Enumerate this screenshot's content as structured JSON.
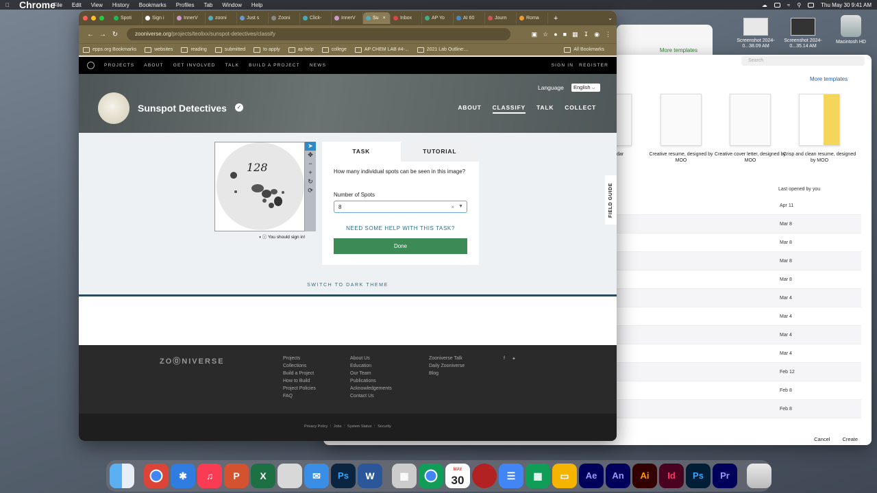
{
  "menubar": {
    "app": "Chrome",
    "items": [
      "File",
      "Edit",
      "View",
      "History",
      "Bookmarks",
      "Profiles",
      "Tab",
      "Window",
      "Help"
    ],
    "clock": "Thu May 30  9:41 AM"
  },
  "desktop": {
    "icons": [
      {
        "label": "Screenshot 2024-0...38.09 AM"
      },
      {
        "label": "Screenshot 2024-0...35.14 AM"
      },
      {
        "label": "Macintosh HD"
      }
    ]
  },
  "docwin": {
    "more_templates": "More templates",
    "templates": [
      {
        "label": "dar"
      },
      {
        "label": "Creative resume, designed by MOO"
      },
      {
        "label": "Creative cover letter, designed by MOO"
      },
      {
        "label": "Crisp and clean resume, designed by MOO"
      }
    ],
    "search_placeholder": "Search",
    "col_header": "Last opened by you",
    "rows": [
      "Apr 11",
      "Mar 8",
      "Mar 8",
      "Mar 8",
      "Mar 8",
      "Mar 4",
      "Mar 4",
      "Mar 4",
      "Mar 4",
      "Feb 12",
      "Feb 8",
      "Feb 8"
    ],
    "cancel": "Cancel",
    "create": "Create"
  },
  "chrome": {
    "tabs": [
      "Spoti",
      "Sign i",
      "InnerV",
      "zooni",
      "Just s",
      "Zooni",
      "Click-",
      "InnerV",
      "Su",
      "Inbox",
      "AP Yo",
      "AI 60",
      "Journ",
      "Roma"
    ],
    "url_host": "zooniverse.org",
    "url_path": "/projects/teolixx/sunspot-detectives/classify",
    "bookmarks": [
      "epps.org Bookmarks",
      "websites",
      "reading",
      "submitted",
      "to apply",
      "ap help",
      "college",
      "AP CHEM LAB #4-...",
      "2021 Lab Outline:..."
    ],
    "all_bookmarks": "All Bookmarks"
  },
  "znav": {
    "links": [
      "PROJECTS",
      "ABOUT",
      "GET INVOLVED",
      "TALK",
      "BUILD A PROJECT",
      "NEWS"
    ],
    "signin": "SIGN IN",
    "register": "REGISTER"
  },
  "project": {
    "name": "Sunspot Detectives",
    "language_label": "Language",
    "language_value": "English",
    "links": [
      "ABOUT",
      "CLASSIFY",
      "TALK",
      "COLLECT"
    ]
  },
  "subject": {
    "number": "128"
  },
  "signin_hint": "You should sign in!",
  "task": {
    "tab_task": "TASK",
    "tab_tutorial": "TUTORIAL",
    "question": "How many individual spots can be seen in this image?",
    "field_label": "Number of Spots",
    "value": "8",
    "help": "NEED SOME HELP WITH THIS TASK?",
    "done": "Done"
  },
  "field_guide": "FIELD GUIDE",
  "dark_theme": "SWITCH TO DARK THEME",
  "footer": {
    "logo": "ZO⓪NIVERSE",
    "col1": [
      "Projects",
      "Collections",
      "Build a Project",
      "How to Build",
      "Project Policies",
      "FAQ"
    ],
    "col2": [
      "About Us",
      "Education",
      "Our Team",
      "Publications",
      "Acknowledgements",
      "Contact Us"
    ],
    "col3": [
      "Zooniverse Talk",
      "Daily Zooniverse",
      "Blog"
    ],
    "legal": [
      "Privacy Policy",
      "Jobs",
      "System Status",
      "Security"
    ]
  },
  "dock": {
    "calendar_month": "MAY",
    "calendar_day": "30",
    "apps": [
      "Ps",
      "Ae",
      "An",
      "Ai",
      "Id",
      "Ps",
      "Pr"
    ]
  }
}
